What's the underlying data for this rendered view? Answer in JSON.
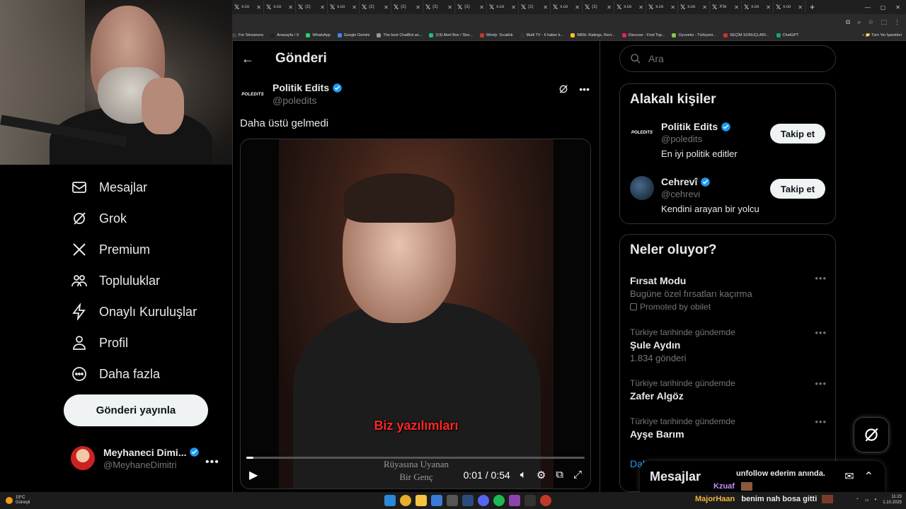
{
  "browser": {
    "tabs": [
      {
        "label": "x.co"
      },
      {
        "label": "x.co"
      },
      {
        "label": "(1)"
      },
      {
        "label": "x.co"
      },
      {
        "label": "(1)"
      },
      {
        "label": "(1)"
      },
      {
        "label": "(1)"
      },
      {
        "label": "(1)"
      },
      {
        "label": "x.co"
      },
      {
        "label": "(1)"
      },
      {
        "label": "x.co"
      },
      {
        "label": "(1)"
      },
      {
        "label": "x.co"
      },
      {
        "label": "x.co"
      },
      {
        "label": "x.co"
      },
      {
        "label": "X'te"
      },
      {
        "label": "x.co"
      },
      {
        "label": "x.co"
      }
    ],
    "bookmarks": [
      {
        "label": "For Streamers",
        "color": "#444"
      },
      {
        "label": "Anasayfa / X",
        "color": "#222"
      },
      {
        "label": "WhatsApp",
        "color": "#25d366"
      },
      {
        "label": "Google Gemini",
        "color": "#4285f4"
      },
      {
        "label": "The best ChatBot an...",
        "color": "#999"
      },
      {
        "label": "(19) Alert Box / Stre...",
        "color": "#1abc9c"
      },
      {
        "label": "Windy: Sıcaklık",
        "color": "#c0392b"
      },
      {
        "label": "Multi TV - 6 haber k...",
        "color": "#333"
      },
      {
        "label": "IMDb: Ratings, Revi...",
        "color": "#f5c518"
      },
      {
        "label": "Discover - Find Top...",
        "color": "#e91e63"
      },
      {
        "label": "Oyuneks - Türkiyeni...",
        "color": "#8bc34a"
      },
      {
        "label": "SEÇİM SONUÇLARI...",
        "color": "#d32f2f"
      },
      {
        "label": "ChatGPT",
        "color": "#10a37f"
      }
    ],
    "all_bookmarks": "Tüm Yer İşaretleri"
  },
  "leftnav": {
    "items": [
      {
        "label": "Mesajlar",
        "icon": "envelope-icon"
      },
      {
        "label": "Grok",
        "icon": "grok-icon"
      },
      {
        "label": "Premium",
        "icon": "x-logo-icon"
      },
      {
        "label": "Topluluklar",
        "icon": "people-icon"
      },
      {
        "label": "Onaylı Kuruluşlar",
        "icon": "lightning-icon"
      },
      {
        "label": "Profil",
        "icon": "person-icon"
      },
      {
        "label": "Daha fazla",
        "icon": "more-circle-icon"
      }
    ],
    "post_button": "Gönderi yayınla",
    "account": {
      "name": "Meyhaneci Dimi...",
      "handle": "@MeyhaneDimitri"
    }
  },
  "main": {
    "title": "Gönderi",
    "tweet": {
      "author_logo": "POLEDITS",
      "author_name": "Politik Edits",
      "author_handle": "@poledits",
      "text": "Daha üstü gelmedi"
    },
    "video": {
      "subtitle": "Biz yazılımları",
      "watermark_line1": "Rüyasına Uyanan",
      "watermark_line2": "Bir Genç",
      "current_time": "0:01",
      "duration": "0:54",
      "progress": 0.02
    }
  },
  "right": {
    "search_placeholder": "Ara",
    "related": {
      "title": "Alakalı kişiler",
      "people": [
        {
          "avatar_text": "POLEDITS",
          "name": "Politik Edits",
          "handle": "@poledits",
          "bio": "En iyi politik editler",
          "button": "Takip et"
        },
        {
          "avatar_text": "",
          "name": "Cehrevî",
          "handle": "@cehrevi",
          "bio": "Kendini arayan bir yolcu",
          "button": "Takip et"
        }
      ]
    },
    "trends": {
      "title": "Neler oluyor?",
      "items": [
        {
          "category": "",
          "title": "Fırsat Modu",
          "subtitle": "Bugüne özel fırsatları kaçırma",
          "promoted": "Promoted by obilet"
        },
        {
          "category": "Türkiye tarihinde gündemde",
          "title": "Şule Aydın",
          "subtitle": "1.834 gönderi"
        },
        {
          "category": "Türkiye tarihinde gündemde",
          "title": "Zafer Algöz",
          "subtitle": ""
        },
        {
          "category": "Türkiye tarihinde gündemde",
          "title": "Ayşe Barım",
          "subtitle": ""
        }
      ],
      "show_more": "Daha"
    },
    "messages_drawer": "Mesajlar"
  },
  "chat_overlay": [
    {
      "user": "",
      "text": "unfollow ederim anında."
    },
    {
      "user": "Kzuaf",
      "text": ""
    },
    {
      "user": "MajorHaan",
      "text": "benim nah bosa gitti"
    }
  ],
  "taskbar": {
    "temperature": "19°C",
    "weather": "Güneşli",
    "time": "11:23",
    "date": "1.10.2025"
  },
  "colors": {
    "verified": "#1d9bf0",
    "background": "#000000",
    "muted_text": "#71767b",
    "subtitle_red": "#ff2626"
  }
}
